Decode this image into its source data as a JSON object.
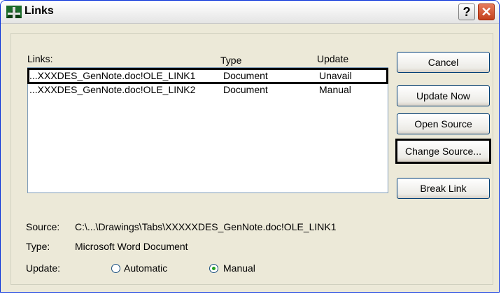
{
  "window": {
    "title": "Links",
    "help_label": "?",
    "close_label": "✕"
  },
  "list": {
    "header_links": "Links:",
    "header_type": "Type",
    "header_update": "Update",
    "rows": [
      {
        "link": "...XXXDES_GenNote.doc!OLE_LINK1",
        "type": "Document",
        "update": "Unavail",
        "selected": true
      },
      {
        "link": "...XXXDES_GenNote.doc!OLE_LINK2",
        "type": "Document",
        "update": "Manual",
        "selected": false
      }
    ]
  },
  "buttons": {
    "cancel": "Cancel",
    "update_now": "Update Now",
    "open_source": "Open Source",
    "change_source": "Change Source...",
    "break_link": "Break Link"
  },
  "details": {
    "source_label": "Source:",
    "source_value": "C:\\...\\Drawings\\Tabs\\XXXXXDES_GenNote.doc!OLE_LINK1",
    "type_label": "Type:",
    "type_value": "Microsoft Word Document",
    "update_label": "Update:",
    "automatic_label": "Automatic",
    "manual_label": "Manual",
    "selected_update": "Manual"
  },
  "colors": {
    "dialog_bg": "#ece9d8",
    "accent_border": "#0831d9",
    "radio_selected": "#21a121"
  }
}
